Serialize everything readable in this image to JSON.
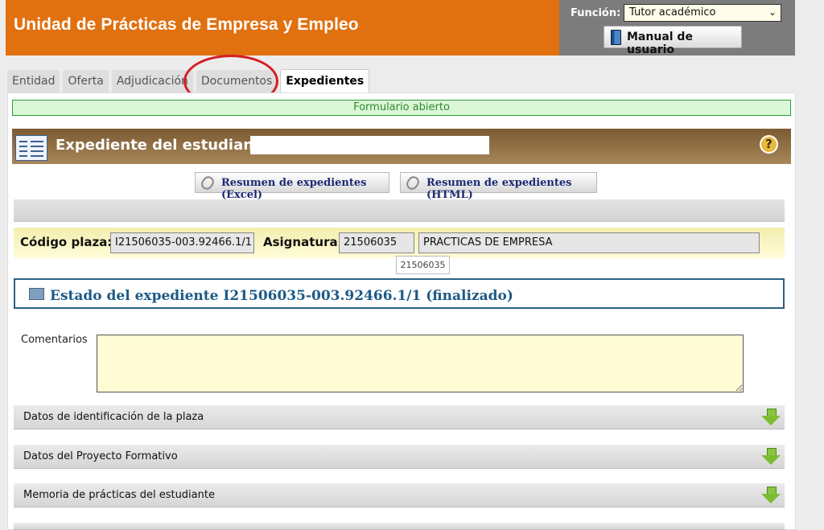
{
  "header": {
    "title": "Unidad de Prácticas de Empresa y Empleo",
    "funcion_label": "Función:",
    "funcion_value": "Tutor académico",
    "manual_label": "Manual de usuario"
  },
  "tabs": [
    {
      "label": "Entidad",
      "active": false
    },
    {
      "label": "Oferta",
      "active": false
    },
    {
      "label": "Adjudicación",
      "active": false
    },
    {
      "label": "Documentos",
      "active": false
    },
    {
      "label": "Expedientes",
      "active": true
    }
  ],
  "status": "Formulario abierto",
  "expediente": {
    "title": "Expediente del estudiante",
    "help": "?"
  },
  "buttons": {
    "excel": "Resumen de expedientes (Excel)",
    "html": "Resumen de expedientes (HTML)"
  },
  "plaza": {
    "codigo_label": "Código plaza:",
    "codigo_value": "I21506035-003.92466.1/1",
    "asignatura_label": "Asignatura:",
    "asignatura_code": "21506035",
    "asignatura_name": "PRACTICAS DE EMPRESA",
    "tooltip": "21506035"
  },
  "estado": {
    "title": "Estado del expediente I21506035-003.92466.1/1 (finalizado)"
  },
  "comentarios": {
    "label": "Comentarios",
    "value": ""
  },
  "sections": [
    "Datos de identificación de la plaza",
    "Datos del Proyecto Formativo",
    "Memoria de prácticas del estudiante"
  ],
  "colors": {
    "header_orange": "#e1700f",
    "header_gray": "#7c7c7c",
    "status_green": "#27a12e",
    "estado_blue": "#1d5a86"
  }
}
